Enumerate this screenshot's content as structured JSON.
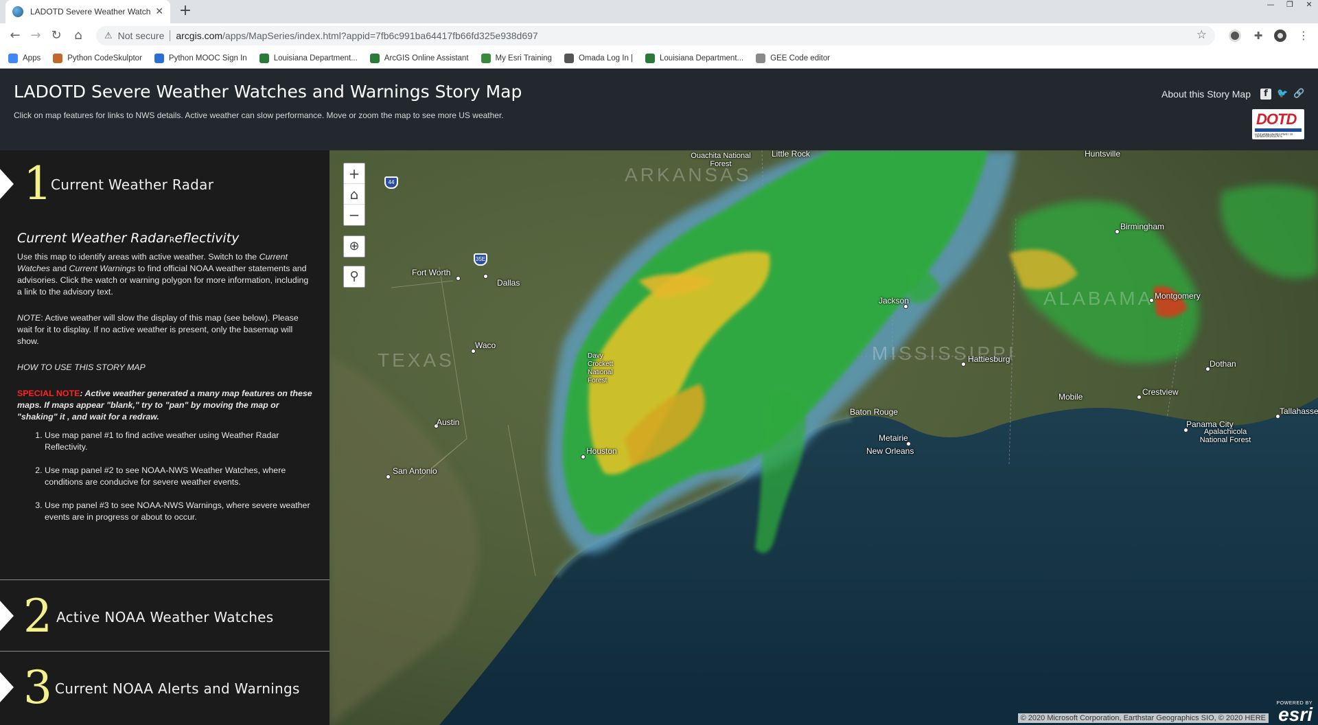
{
  "browser": {
    "tab_title": "LADOTD Severe Weather Watches and Warnings Story Map",
    "new_tab": "+",
    "url_warning": "Not secure",
    "url_host": "arcgis.com",
    "url_path": "/apps/MapSeries/index.html?appid=7fb6c991ba64417fb66fd325e938d697",
    "bookmarks": [
      {
        "label": "Apps",
        "color": "#4285f4"
      },
      {
        "label": "Python CodeSkulptor",
        "color": "#c0692a"
      },
      {
        "label": "Python MOOC Sign In",
        "color": "#2b6fd6"
      },
      {
        "label": "Louisiana Department...",
        "color": "#2b7a3a"
      },
      {
        "label": "ArcGIS Online Assistant",
        "color": "#2b7a3a"
      },
      {
        "label": "My Esri Training",
        "color": "#3b8a3b"
      },
      {
        "label": "Omada Log In |",
        "color": "#555555"
      },
      {
        "label": "Louisiana Department...",
        "color": "#2b7a3a"
      },
      {
        "label": "GEE Code editor",
        "color": "#8a8a8a"
      }
    ]
  },
  "header": {
    "title": "LADOTD Severe Weather Watches and Warnings Story Map",
    "subtitle": "Click on map features for links to NWS details. Active weather can slow performance. Move or zoom the map to see more US weather.",
    "about": "About this Story Map",
    "logo_text": "DOTD",
    "logo_small": "LOUISIANA DEPARTMENT OF TRANSPORTATION & DEVELOPMENT"
  },
  "panel": {
    "sections": [
      {
        "number": "1",
        "title": "Current Weather Radar"
      },
      {
        "number": "2",
        "title": "Active NOAA Weather Watches"
      },
      {
        "number": "3",
        "title": "Current NOAA Alerts and Warnings"
      }
    ],
    "content": {
      "heading": "Current Weather Radar",
      "heading_tail_small": "R",
      "heading_tail": "eflectivity",
      "p1_a": "Use this map to identify areas with active weather. Switch to the ",
      "p1_em1": "Current Watches",
      "p1_b": " and ",
      "p1_em2": "Current Warnings",
      "p1_c": " to find official NOAA weather statements and advisories. Click the watch or warning polygon for more information, including a link to the advisory text.",
      "p2_em": "NOTE",
      "p2_text": ": Active weather will slow the display of this map (see below). Please wait for it to display. If no active weather is present, only the basemap will show.",
      "p3": "HOW TO USE THIS STORY MAP",
      "p4_red": "SPECIAL NOTE",
      "p4_text": ": Active weather generated a many map features on these maps. If maps appear \"blank,\" try to \"pan\" by moving the map or \"shaking\" it , and wait for a redraw.",
      "steps": [
        "Use map panel #1 to find active weather using Weather Radar Reflectivity.",
        "Use map panel #2 to see NOAA-NWS Weather Watches, where conditions are conducive for severe weather events.",
        "Use mp panel #3 to see NOAA-NWS Warnings, where severe weather events are in progress or about to occur."
      ]
    }
  },
  "map": {
    "zoom_in": "+",
    "zoom_out": "−",
    "attribution": "© 2020 Microsoft Corporation, Earthstar Geographics SIO, © 2020 HERE",
    "esri_powered": "POWERED BY",
    "esri_logo": "esri",
    "shields": [
      "44",
      "35E"
    ],
    "states": [
      "TEXAS",
      "ARKANSAS",
      "MISSISSIPPI",
      "ALABAMA"
    ],
    "cities": [
      "Fort Worth",
      "Dallas",
      "Waco",
      "Austin",
      "San Antonio",
      "Houston",
      "Baton Rouge",
      "Metairie",
      "New Orleans",
      "Hattiesburg",
      "Jackson",
      "Mobile",
      "Birmingham",
      "Montgomery",
      "Dothan",
      "Crestview",
      "Panama City",
      "Tallahassee",
      "Huntsville",
      "Little Rock",
      "Ouachita National Forest",
      "Davy Crockett National Forest",
      "Apalachicola National Forest"
    ]
  }
}
